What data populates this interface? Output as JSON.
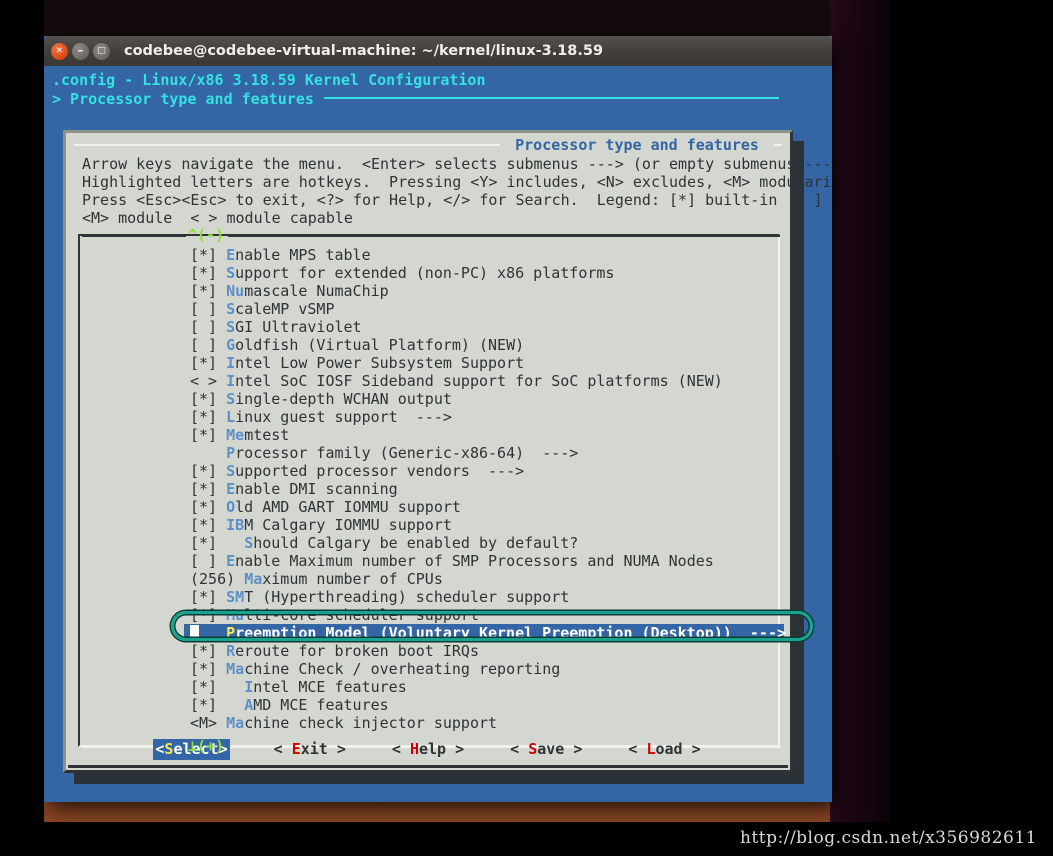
{
  "window": {
    "title": "codebee@codebee-virtual-machine: ~/kernel/linux-3.18.59",
    "close_glyph": "✕",
    "minimize_glyph": "–",
    "maximize_glyph": "□"
  },
  "terminal": {
    "line1": ".config - Linux/x86 3.18.59 Kernel Configuration",
    "line2": "> Processor type and features"
  },
  "dialog": {
    "title": " Processor type and features ",
    "help_lines": [
      "Arrow keys navigate the menu.  <Enter> selects submenus ---> (or empty submenus ----).",
      "Highlighted letters are hotkeys.  Pressing <Y> includes, <N> excludes, <M> modularizes features.",
      "Press <Esc><Esc> to exit, <?> for Help, </> for Search.  Legend: [*] built-in  [ ] excluded",
      "<M> module  < > module capable"
    ],
    "scroll_up_indicator": "^(-)",
    "scroll_down_indicator": "⊥(+)"
  },
  "menu": {
    "items": [
      {
        "mark": "[*] ",
        "hot": "E",
        "rest": "nable MPS table"
      },
      {
        "mark": "[*] ",
        "hot": "S",
        "rest": "upport for extended (non-PC) x86 platforms"
      },
      {
        "mark": "[*] ",
        "hot": "Nu",
        "rest": "mascale NumaChip"
      },
      {
        "mark": "[ ] ",
        "hot": "S",
        "rest": "caleMP vSMP"
      },
      {
        "mark": "[ ] ",
        "hot": "S",
        "rest": "GI Ultraviolet"
      },
      {
        "mark": "[ ] ",
        "hot": "G",
        "rest": "oldfish (Virtual Platform) (NEW)"
      },
      {
        "mark": "[*] ",
        "hot": "I",
        "rest": "ntel Low Power Subsystem Support"
      },
      {
        "mark": "< > ",
        "hot": "I",
        "rest": "ntel SoC IOSF Sideband support for SoC platforms (NEW)"
      },
      {
        "mark": "[*] ",
        "hot": "S",
        "rest": "ingle-depth WCHAN output"
      },
      {
        "mark": "[*] ",
        "hot": "L",
        "rest": "inux guest support  --->"
      },
      {
        "mark": "[*] ",
        "hot": "Me",
        "rest": "mtest"
      },
      {
        "mark": "    ",
        "hot": "P",
        "rest": "rocessor family (Generic-x86-64)  --->"
      },
      {
        "mark": "[*] ",
        "hot": "S",
        "rest": "upported processor vendors  --->"
      },
      {
        "mark": "[*] ",
        "hot": "E",
        "rest": "nable DMI scanning"
      },
      {
        "mark": "[*] ",
        "hot": "O",
        "rest": "ld AMD GART IOMMU support"
      },
      {
        "mark": "[*] ",
        "hot": "IB",
        "rest": "M Calgary IOMMU support"
      },
      {
        "mark": "[*]   ",
        "hot": "S",
        "rest": "hould Calgary be enabled by default?"
      },
      {
        "mark": "[ ] ",
        "hot": "E",
        "rest": "nable Maximum number of SMP Processors and NUMA Nodes"
      },
      {
        "mark": "(256) ",
        "hot": "Ma",
        "rest": "ximum number of CPUs"
      },
      {
        "mark": "[*] ",
        "hot": "SM",
        "rest": "T (Hyperthreading) scheduler support"
      },
      {
        "mark": "[*] ",
        "hot": "Mu",
        "rest": "lti-core scheduler support"
      },
      {
        "mark": "    ",
        "hot": "P",
        "rest": "reemption Model (Voluntary Kernel Preemption (Desktop))  --->",
        "selected": true,
        "cursor": true
      },
      {
        "mark": "[*] ",
        "hot": "R",
        "rest": "eroute for broken boot IRQs"
      },
      {
        "mark": "[*] ",
        "hot": "Ma",
        "rest": "chine Check / overheating reporting"
      },
      {
        "mark": "[*]   ",
        "hot": "I",
        "rest": "ntel MCE features"
      },
      {
        "mark": "[*]   ",
        "hot": "A",
        "rest": "MD MCE features"
      },
      {
        "mark": "<M> ",
        "hot": "Ma",
        "rest": "chine check injector support"
      }
    ]
  },
  "buttons": [
    {
      "pre": "<",
      "hot": "S",
      "post": "elect>",
      "active": true
    },
    {
      "pre": "< ",
      "hot": "E",
      "post": "xit >",
      "active": false
    },
    {
      "pre": "< ",
      "hot": "H",
      "post": "elp >",
      "active": false
    },
    {
      "pre": "< ",
      "hot": "S",
      "post": "ave >",
      "active": false
    },
    {
      "pre": "< ",
      "hot": "L",
      "post": "oad >",
      "active": false
    }
  ],
  "watermark": "http://blog.csdn.net/x356982611",
  "colors": {
    "terminal_bg": "#3465a4",
    "dialog_bg": "#d3d7cf",
    "cyan": "#34e2e2",
    "hotkey_blue": "#5c8fc9",
    "hotkey_red": "#cc0000",
    "hotkey_yellow": "#fce94f",
    "scroll_green": "#8ae234",
    "annotation": "#18a58f"
  }
}
